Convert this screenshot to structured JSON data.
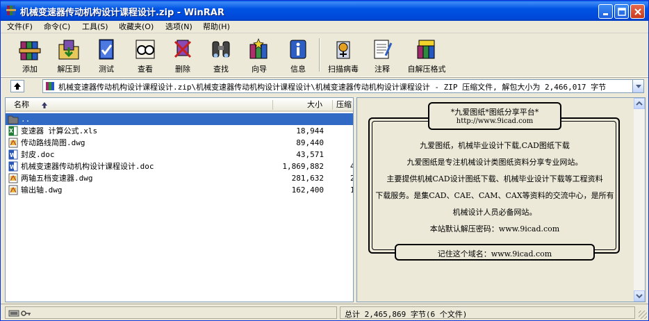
{
  "window": {
    "title": "机械变速器传动机构设计课程设计.zip - WinRAR"
  },
  "menu": [
    {
      "label": "文件(F)"
    },
    {
      "label": "命令(C)"
    },
    {
      "label": "工具(S)"
    },
    {
      "label": "收藏夹(O)"
    },
    {
      "label": "选项(N)"
    },
    {
      "label": "帮助(H)"
    }
  ],
  "toolbar": [
    {
      "label": "添加",
      "icon": "books-add-icon"
    },
    {
      "label": "解压到",
      "icon": "folder-extract-icon"
    },
    {
      "label": "测试",
      "icon": "test-book-icon"
    },
    {
      "label": "查看",
      "icon": "view-glasses-icon"
    },
    {
      "label": "删除",
      "icon": "delete-icon"
    },
    {
      "label": "查找",
      "icon": "binoculars-icon"
    },
    {
      "label": "向导",
      "icon": "wizard-icon"
    },
    {
      "label": "信息",
      "icon": "info-icon"
    },
    {
      "label": "扫描病毒",
      "icon": "virus-scan-icon"
    },
    {
      "label": "注释",
      "icon": "comment-icon"
    },
    {
      "label": "自解压格式",
      "icon": "sfx-icon"
    }
  ],
  "address": {
    "path": "机械变速器传动机构设计课程设计.zip\\机械变速器传动机构设计课程设计\\机械变速器传动机构设计课程设计 - ZIP 压缩文件, 解包大小为 2,466,017 字节"
  },
  "columns": {
    "name": "名称",
    "size": "大小",
    "ratio": "压缩"
  },
  "files": [
    {
      "name": "..",
      "size": "",
      "ratio": "",
      "type": "folder"
    },
    {
      "name": "变速器 计算公式.xls",
      "size": "18,944",
      "ratio": "",
      "type": "xls"
    },
    {
      "name": "传动路线简图.dwg",
      "size": "89,440",
      "ratio": "",
      "type": "dwg"
    },
    {
      "name": "封皮.doc",
      "size": "43,571",
      "ratio": "",
      "type": "doc"
    },
    {
      "name": "机械变速器传动机构设计课程设计.doc",
      "size": "1,869,882",
      "ratio": "4",
      "type": "doc"
    },
    {
      "name": "两轴五档变速器.dwg",
      "size": "281,632",
      "ratio": "2",
      "type": "dwg"
    },
    {
      "name": "输出轴.dwg",
      "size": "162,400",
      "ratio": "1",
      "type": "dwg"
    }
  ],
  "comment": {
    "badge_title": "*九爱图纸*图纸分享平台*",
    "badge_url": "http://www.9icad.com",
    "lines": [
      "九爱图纸，机械毕业设计下载,CAD图纸下载",
      "九爱图纸是专注机械设计类图纸资料分享专业网站。",
      "主要提供机械CAD设计图纸下载、机械毕业设计下载等工程资料",
      "下载服务。是集CAD、CAE、CAM、CAX等资料的交流中心，是所有",
      "机械设计人员必备网站。",
      "本站默认解压密码：www.9icad.com"
    ],
    "footer": "记住这个域名：www.9icad.com"
  },
  "status": {
    "right": "总计 2,465,869 字节(6 个文件)"
  },
  "colors": {
    "selection": "#316ac5",
    "title_blue": "#0054e3"
  }
}
